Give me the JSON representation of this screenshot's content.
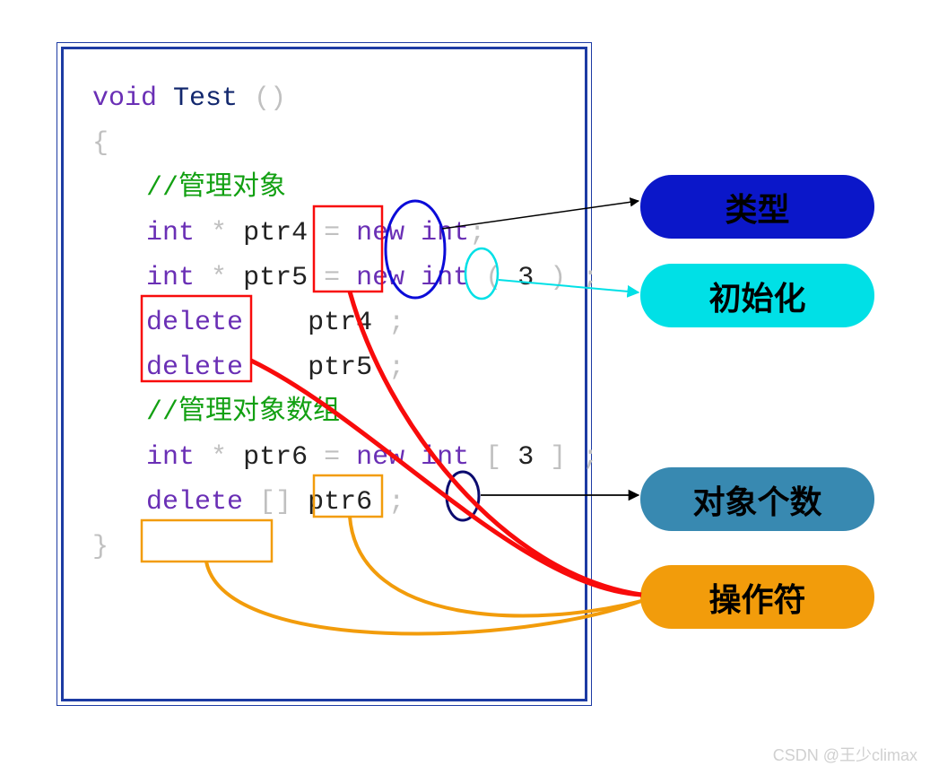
{
  "code": {
    "keyword_void": "void",
    "fn_test": "Test",
    "paren": "()",
    "brace_open": "{",
    "brace_close": "}",
    "comment_obj": "//管理对象",
    "kw_int": "int",
    "star": "*",
    "ptr4": "ptr4",
    "ptr5": "ptr5",
    "ptr6": "ptr6",
    "eq": "=",
    "kw_new": "new",
    "val_3": "3",
    "semi": ";",
    "kw_delete": "delete",
    "comment_arr": "//管理对象数组",
    "lbrack": "[",
    "rbrack": "]",
    "lparen": "(",
    "rparen": ")",
    "space": " "
  },
  "pills": {
    "type": "类型",
    "init": "初始化",
    "count": "对象个数",
    "op": "操作符"
  },
  "watermark": "CSDN @王少climax",
  "colors": {
    "frame": "#1d3ba3",
    "kw": "#6a2fb5",
    "fn": "#13286e",
    "cm": "#12a012",
    "red": "#f80b0b",
    "blue": "#0b0bd8",
    "cyan": "#00e0e6",
    "navy": "#0b0b6f",
    "orange": "#f29c0b",
    "steel": "#3889b1",
    "darkblue": "#0b17c9"
  }
}
